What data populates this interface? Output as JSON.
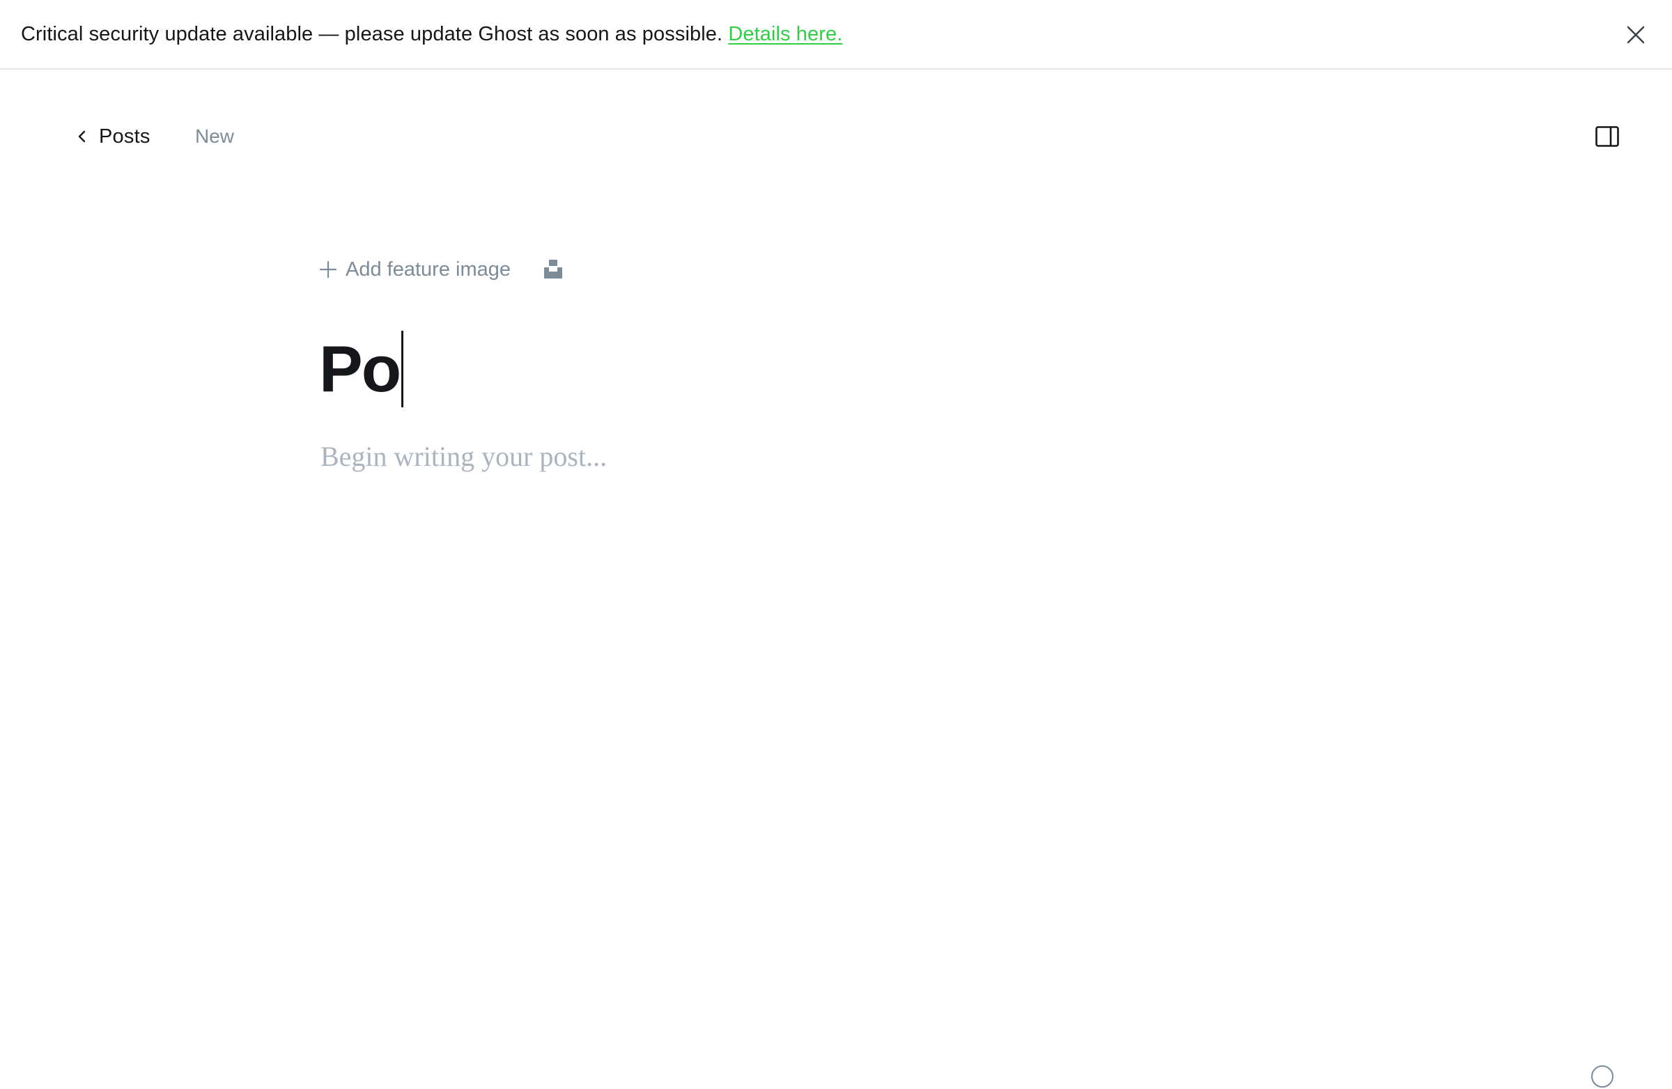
{
  "banner": {
    "message": "Critical security update available — please update Ghost as soon as possible. ",
    "link_label": "Details here.",
    "close_icon": "close-icon"
  },
  "header": {
    "back_label": "Posts",
    "back_icon": "chevron-left-icon",
    "status": "New",
    "sidebar_toggle_icon": "sidebar-panel-icon"
  },
  "editor": {
    "feature_image_label": "Add feature image",
    "feature_image_icon": "plus-icon",
    "unsplash_icon": "unsplash-icon",
    "title_value": "Po",
    "body_placeholder": "Begin writing your post..."
  },
  "footer": {
    "help_icon": "help-circle-icon"
  },
  "colors": {
    "accent_link": "#30cf43",
    "text_primary": "#15171a",
    "text_muted": "#7c8b9a",
    "placeholder": "#abb4be",
    "divider": "#e3e5e8"
  }
}
